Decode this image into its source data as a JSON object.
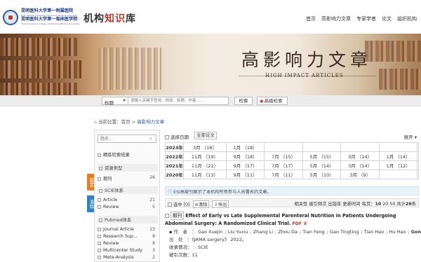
{
  "header": {
    "logo_line1": "昆明医科大学第一附属医院",
    "logo_line2": "昆明医科大学第一临床医学院",
    "logo_en_1": "First Affiliated Hospital of Kunming Medical University",
    "logo_en_2": "The First Clinical College of Kunming Medical University",
    "title_plain_a": "机构",
    "title_accent": "知识",
    "title_plain_b": "库",
    "nav": [
      "首页",
      "高影响力文章",
      "专家学者",
      "论文",
      "组织机构"
    ]
  },
  "banner": {
    "title_cn": "高影响力文章",
    "title_en": "HIGH IMPACT ARTICLES"
  },
  "search": {
    "field_select": "标题",
    "placeholder": "请输入关键字查询，例如：标题、作者……",
    "search_button": "检索",
    "advanced_button": "高级检索"
  },
  "breadcrumb": {
    "prefix": "当前位置：",
    "home": "首页",
    "separator": ">",
    "current": "高影响力文章"
  },
  "sidebar": {
    "search_placeholder": "题名...",
    "refine_label": "精炼检索结果",
    "groups": [
      {
        "label": "资源类型",
        "items": [
          {
            "label": "期刊",
            "count": "26"
          }
        ]
      },
      {
        "label": "SCIE体系",
        "items": [
          {
            "label": "Article",
            "count": "21"
          },
          {
            "label": "Review",
            "count": "5"
          }
        ]
      },
      {
        "label": "Pubmed体系",
        "items": [
          {
            "label": "Journal Article",
            "count": "23"
          },
          {
            "label": "Research Sup...",
            "count": "8"
          },
          {
            "label": "Review",
            "count": "8"
          },
          {
            "label": "Multicenter Study",
            "count": "3"
          },
          {
            "label": "Meta-Analysis",
            "count": "2"
          }
        ]
      }
    ],
    "tab_limit": "限定",
    "tab_clear": "清除"
  },
  "main": {
    "select_date": "选择日期",
    "all_papers": "全部论文",
    "expand": "展开",
    "date_rows": [
      {
        "year": "2023年",
        "cells": [
          "3月 （18）",
          "1月 （18）",
          "",
          "",
          "",
          "",
          ""
        ]
      },
      {
        "year": "2022年",
        "cells": [
          "11月 （19）",
          "9月 （18）",
          "7月 （15）",
          "5月 （15）",
          "3月 （14）",
          "1月 （14）",
          ""
        ]
      },
      {
        "year": "2021年",
        "cells": [
          "11月 （21）",
          "9月 （17）",
          "7月 （17）",
          "5月 （14）",
          "3月 （14）",
          "1月 （12）",
          ""
        ]
      },
      {
        "year": "2020年",
        "cells": [
          "11月 （13）",
          "9月 （11）",
          "7月 （11）",
          "5月 （10）",
          "3月 （9）",
          "",
          ""
        ]
      }
    ],
    "esi_note": "ESI高被引图示了本机构所有参与人员署名的文章。",
    "toolbar": {
      "select_all": "选中 [0]",
      "clear": "清除",
      "export": "导出",
      "sort_label": "相关性  被引频次  出版年  更新时间",
      "per_page_label": "每页：",
      "per_page_selected": "10",
      "per_page_other": "20  50",
      "total_prefix": "共计",
      "total_count": "26",
      "total_suffix": "条"
    },
    "article": {
      "tag": "期刊",
      "title": "Effect of Early vs Late Supplemental Parenteral Nutrition in Patients Undergoing Abdominal Surgery: A Randomized Clinical Trial.",
      "authors_label": "作　者",
      "authors": [
        "Gao Xuejin",
        "Liu Yuxiu",
        "Zhang Li",
        "Zhou Da",
        "Tian Feng",
        "Gao Tingting",
        "Tian Hao",
        "Hu Hao",
        "Gong Fangy"
      ],
      "source_label": "出　处",
      "source": "《JAMA surgery》 2022。",
      "indexed_label": "收录情况：",
      "indexed": "SCIE",
      "cited_label": "被引次数：",
      "cited": "11"
    }
  }
}
